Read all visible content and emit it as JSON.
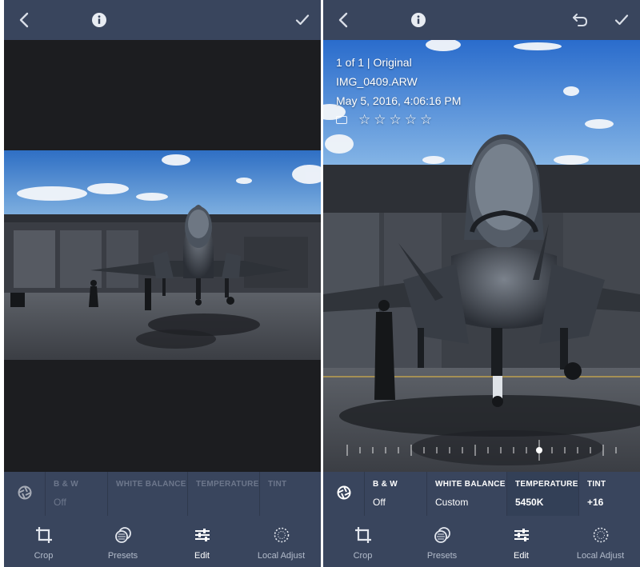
{
  "left_panel": {
    "tools": {
      "bw": {
        "label": "B & W",
        "value": "Off"
      },
      "white_balance": {
        "label": "WHITE BALANCE",
        "value": ""
      },
      "temperature": {
        "label": "TEMPERATURE",
        "value": ""
      },
      "tint": {
        "label": "TINT",
        "value": ""
      }
    },
    "nav": {
      "crop": "Crop",
      "presets": "Presets",
      "edit": "Edit",
      "local_adjust": "Local Adjust"
    }
  },
  "right_panel": {
    "info": {
      "position": "1 of 1 | Original",
      "filename": "IMG_0409.ARW",
      "datetime": "May 5, 2016, 4:06:16 PM",
      "stars": [
        "☆",
        "☆",
        "☆",
        "☆",
        "☆"
      ]
    },
    "tools": {
      "bw": {
        "label": "B & W",
        "value": "Off"
      },
      "white_balance": {
        "label": "WHITE BALANCE",
        "value": "Custom"
      },
      "temperature": {
        "label": "TEMPERATURE",
        "value": "5450K"
      },
      "tint": {
        "label": "TINT",
        "value": "+16"
      }
    },
    "nav": {
      "crop": "Crop",
      "presets": "Presets",
      "edit": "Edit",
      "local_adjust": "Local Adjust"
    }
  },
  "icons": {
    "back": "chevron-left-icon",
    "info": "info-icon",
    "undo": "undo-icon",
    "confirm": "checkmark-icon",
    "aperture": "aperture-icon",
    "crop": "crop-icon",
    "presets": "presets-icon",
    "edit": "sliders-icon",
    "local_adjust": "local-adjust-icon"
  },
  "colors": {
    "bar": "#39455d",
    "canvas": "#1c1d20",
    "active_text": "#ffffff",
    "inactive_text": "#b3bccb",
    "disabled_text": "#6d778c"
  }
}
